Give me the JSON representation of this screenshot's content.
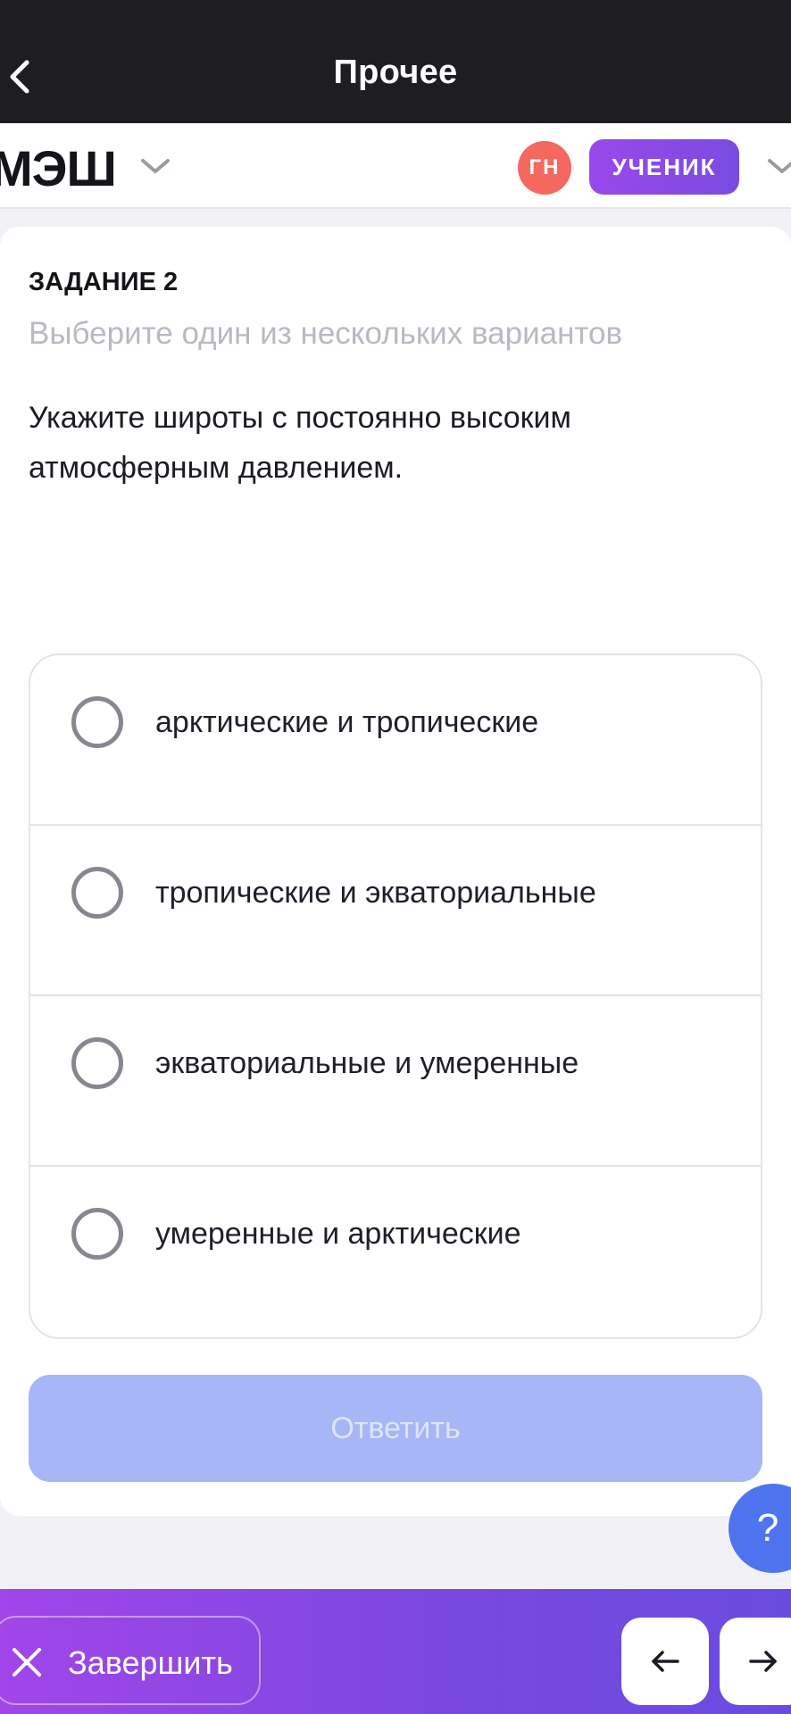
{
  "topbar": {
    "title": "Прочее"
  },
  "header": {
    "logo": "МЭШ",
    "avatar_initials": "ГН",
    "role": "УЧЕНИК"
  },
  "task": {
    "label": "ЗАДАНИЕ 2",
    "hint": "Выберите один из нескольких вариантов",
    "question": "Укажите широты с постоянно высоким атмосферным давлением.",
    "options": [
      {
        "label": "арктические и тропические",
        "selected": false
      },
      {
        "label": "тропические и экваториальные",
        "selected": false
      },
      {
        "label": "экваториальные и умеренные",
        "selected": false
      },
      {
        "label": "умеренные и арктические",
        "selected": false
      }
    ],
    "answer_button": "Ответить"
  },
  "help": {
    "label": "?"
  },
  "bottombar": {
    "finish_label": "Завершить"
  },
  "colors": {
    "topbar": "#1e1d22",
    "avatar": "#f4685f",
    "role_badge": "#8a4ae6",
    "answer_disabled": "#a7b6f6",
    "help": "#4f74f0",
    "bottombar": "#7a48e0"
  },
  "icons": {
    "back": "chevron-left-icon",
    "logo_dropdown": "chevron-down-icon",
    "role_dropdown": "chevron-down-icon",
    "finish": "close-icon",
    "prev": "arrow-left-icon",
    "next": "arrow-right-icon"
  }
}
